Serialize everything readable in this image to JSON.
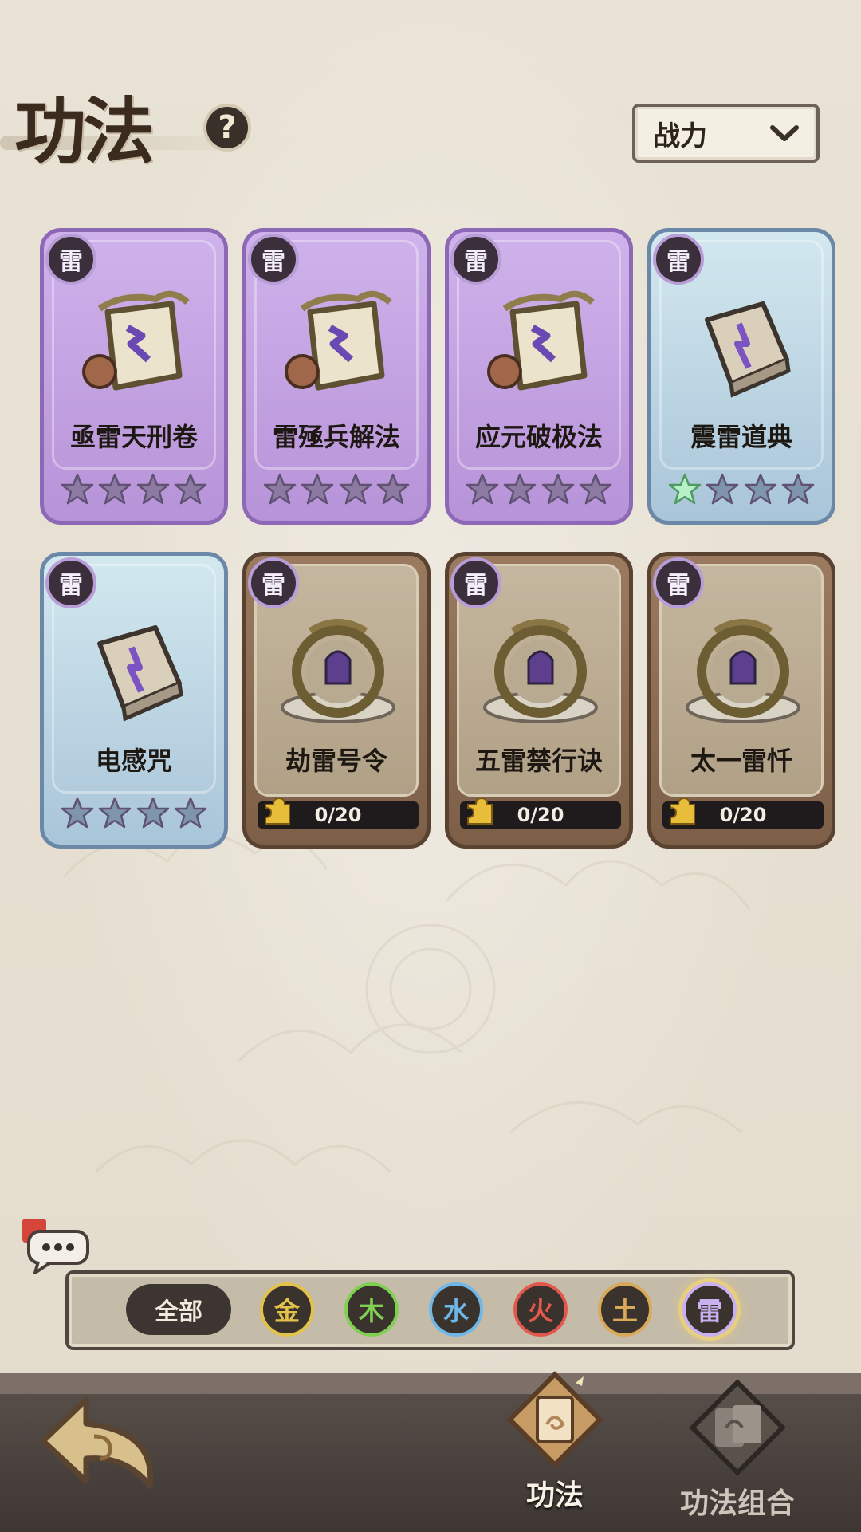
{
  "header": {
    "title": "功法",
    "help_label": "?",
    "sort_label": "战力"
  },
  "element_badge": "雷",
  "cards": [
    {
      "name": "亟雷天刑卷",
      "rarity": "purple",
      "stars_lit": 0,
      "stars_total": 4
    },
    {
      "name": "雷殛兵解法",
      "rarity": "purple",
      "stars_lit": 0,
      "stars_total": 4
    },
    {
      "name": "应元破极法",
      "rarity": "purple",
      "stars_lit": 0,
      "stars_total": 4
    },
    {
      "name": "震雷道典",
      "rarity": "blue",
      "stars_lit": 1,
      "stars_total": 4
    },
    {
      "name": "电感咒",
      "rarity": "blue",
      "stars_lit": 0,
      "stars_total": 4
    },
    {
      "name": "劫雷号令",
      "rarity": "locked",
      "progress": "0/20",
      "progress_fraction": 0
    },
    {
      "name": "五雷禁行诀",
      "rarity": "locked",
      "progress": "0/20",
      "progress_fraction": 0
    },
    {
      "name": "太一雷忏",
      "rarity": "locked",
      "progress": "0/20",
      "progress_fraction": 0
    }
  ],
  "filter": {
    "all_label": "全部",
    "elements": [
      {
        "label": "金",
        "color": "#e2c24a"
      },
      {
        "label": "木",
        "color": "#7fcf52"
      },
      {
        "label": "水",
        "color": "#6fb7e6"
      },
      {
        "label": "火",
        "color": "#e3584d"
      },
      {
        "label": "土",
        "color": "#d9a95a"
      },
      {
        "label": "雷",
        "color": "#c9b0f0",
        "active": true
      }
    ]
  },
  "bottom_nav": {
    "tab1_label": "功法",
    "tab2_label": "功法组合"
  },
  "colors": {
    "purple_card": "#c3a3e3",
    "blue_card": "#bdd8e6",
    "locked_card": "#8d6d54",
    "star_unlit": "#8c7aa3",
    "star_lit": "#b7f0c6"
  }
}
